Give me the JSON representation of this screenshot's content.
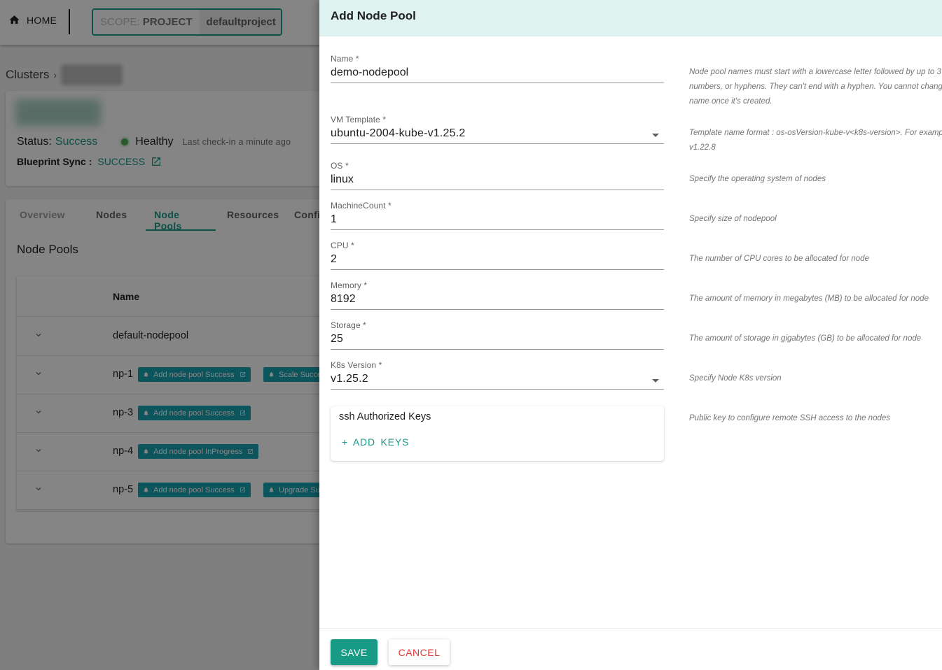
{
  "topbar": {
    "home_label": "HOME",
    "scope_prefix": "SCOPE:",
    "scope_type": "PROJECT",
    "project": "defaultproject"
  },
  "breadcrumb": {
    "root": "Clusters",
    "separator": "›"
  },
  "cluster": {
    "status_label": "Status:",
    "status_value": "Success",
    "health": "Healthy",
    "last_checkin": "Last check-in a minute ago",
    "blueprint_label": "Blueprint Sync :",
    "blueprint_value": "SUCCESS"
  },
  "tabs": [
    {
      "label": "Overview"
    },
    {
      "label": "Nodes"
    },
    {
      "label": "Node Pools",
      "active": true
    },
    {
      "label": "Resources"
    },
    {
      "label": "Confi"
    }
  ],
  "node_pools": {
    "title": "Node Pools",
    "column_name": "Name",
    "rows": [
      {
        "name": "default-nodepool",
        "badges": []
      },
      {
        "name": "np-1",
        "badges": [
          "Add node pool Success",
          "Scale Succe"
        ]
      },
      {
        "name": "np-3",
        "badges": [
          "Add node pool Success"
        ]
      },
      {
        "name": "np-4",
        "badges": [
          "Add node pool InProgress"
        ]
      },
      {
        "name": "np-5",
        "badges": [
          "Add node pool Success",
          "Upgrade Su"
        ]
      }
    ]
  },
  "drawer": {
    "title": "Add Node Pool",
    "fields": {
      "name": {
        "label": "Name *",
        "value": "demo-nodepool",
        "hint": [
          "Node pool names must start with a lowercase letter followed by up to 3",
          "numbers, or hyphens. They can't end with a hyphen. You cannot change",
          "name once it's created."
        ]
      },
      "vm_template": {
        "label": "VM Template *",
        "value": "ubuntu-2004-kube-v1.25.2",
        "hint": [
          "Template name format : os-osVersion-kube-v<k8s-version>. For exampl",
          "v1.22.8"
        ]
      },
      "os": {
        "label": "OS *",
        "value": "linux",
        "hint": [
          "Specify the operating system of nodes"
        ]
      },
      "machine_count": {
        "label": "MachineCount *",
        "value": "1",
        "hint": [
          "Specify size of nodepool"
        ]
      },
      "cpu": {
        "label": "CPU *",
        "value": "2",
        "hint": [
          "The number of CPU cores to be allocated for node"
        ]
      },
      "memory": {
        "label": "Memory *",
        "value": "8192",
        "hint": [
          "The amount of memory in megabytes (MB) to be allocated for node"
        ]
      },
      "storage": {
        "label": "Storage *",
        "value": "25",
        "hint": [
          "The amount of storage in gigabytes (GB) to be allocated for node"
        ]
      },
      "k8s_version": {
        "label": "K8s Version *",
        "value": "v1.25.2",
        "hint": [
          "Specify Node K8s version"
        ]
      }
    },
    "ssh": {
      "title": "ssh Authorized Keys",
      "add_label": "+ ADD  KEYS",
      "hint": "Public key to configure remote SSH access to the nodes"
    },
    "save_label": "SAVE",
    "cancel_label": "CANCEL"
  },
  "colors": {
    "accent": "#179a86",
    "badge": "#1aa3b3",
    "drawer_header": "#dff4f0",
    "cancel": "#e53935",
    "healthy": "#4caf50"
  }
}
